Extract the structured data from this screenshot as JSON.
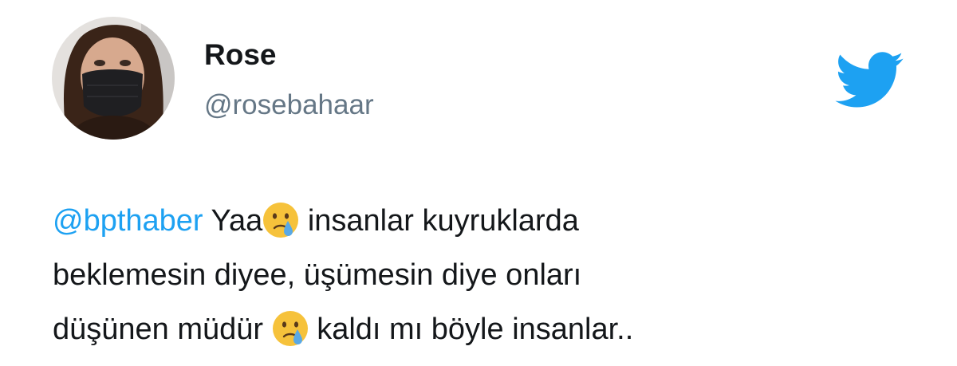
{
  "user": {
    "name": "Rose",
    "handle": "@rosebahaar"
  },
  "icons": {
    "brand": "twitter-bird-icon",
    "emoji": "crying-face-icon"
  },
  "colors": {
    "brand_blue": "#1da1f2",
    "text": "#14171a",
    "secondary": "#657786"
  },
  "tweet": {
    "mention": "@bpthaber",
    "line1_a": " Yaa",
    "line1_b": " insanlar kuyruklarda",
    "line2": "beklemesin diyee, üşümesin diye onları",
    "line3_a": "düşünen müdür ",
    "line3_b": " kaldı mı böyle insanlar.."
  }
}
